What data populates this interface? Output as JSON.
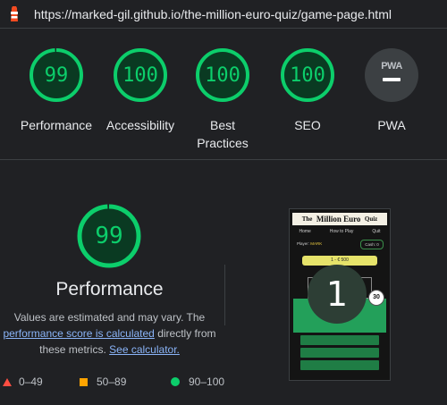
{
  "url": "https://marked-gil.github.io/the-million-euro-quiz/game-page.html",
  "colors": {
    "pass": "#0cce6b",
    "average": "#ffa400",
    "fail": "#ff4e42",
    "background": "#202124"
  },
  "categories": [
    {
      "label": "Performance",
      "score": "99",
      "fraction": 0.99
    },
    {
      "label": "Accessibility",
      "score": "100",
      "fraction": 1.0
    },
    {
      "label": "Best Practices",
      "score": "100",
      "fraction": 1.0
    },
    {
      "label": "SEO",
      "score": "100",
      "fraction": 1.0
    },
    {
      "label": "PWA",
      "badge": "PWA"
    }
  ],
  "performance": {
    "score": "99",
    "fraction": 0.99,
    "title": "Performance",
    "desc_prefix": "Values are estimated and may vary. The",
    "link_score": "performance score is calculated",
    "desc_middle": "directly from these metrics.",
    "link_calc": "See calculator."
  },
  "legend": [
    {
      "icon": "fail-triangle-icon",
      "range": "0–49"
    },
    {
      "icon": "average-square-icon",
      "range": "50–89"
    },
    {
      "icon": "pass-circle-icon",
      "range": "90–100"
    }
  ],
  "screenshot": {
    "title_the": "The",
    "title_main": "Million Euro",
    "title_quiz": "Quiz",
    "nav": [
      "Home",
      "How to Play",
      "Quit"
    ],
    "player_label": "Player:",
    "player_name": "MARK",
    "cash": "Cash: 0",
    "prize": "1 - € 500",
    "question_number": "1",
    "timer": "30"
  }
}
